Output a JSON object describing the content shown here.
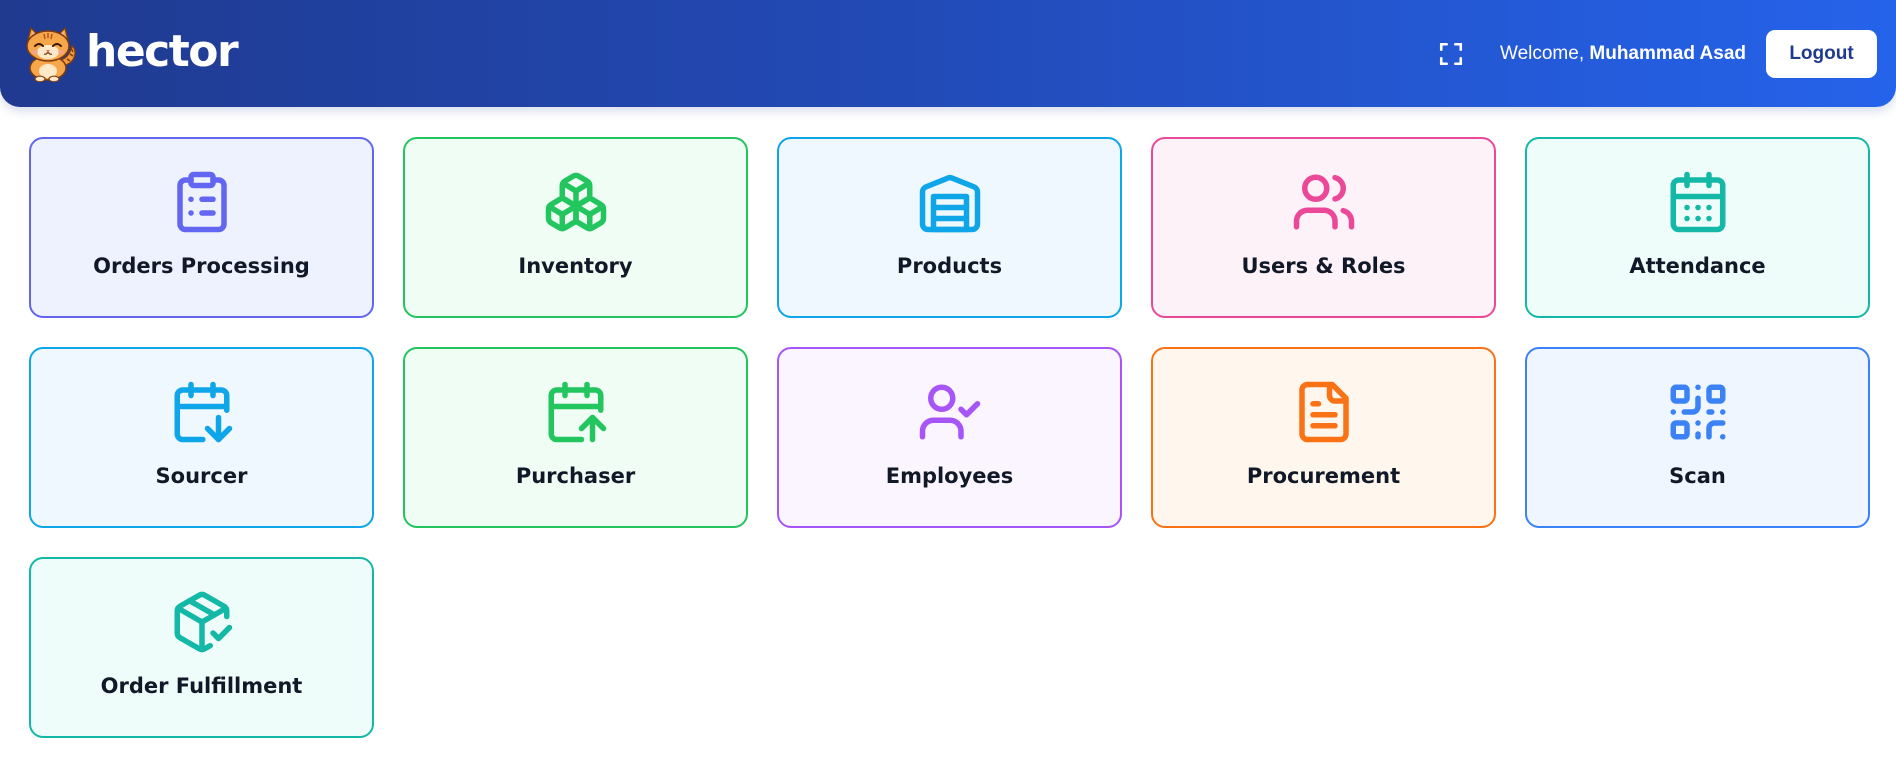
{
  "header": {
    "brand": "hector",
    "welcome_prefix": "Welcome,",
    "user_name": "Muhammad Asad",
    "logout_label": "Logout",
    "gradient_start": "#1f3a8f",
    "gradient_end": "#2563eb"
  },
  "modules": [
    {
      "label": "Orders Processing",
      "icon": "clipboard-list-icon",
      "color": "#6366f1"
    },
    {
      "label": "Inventory",
      "icon": "boxes-icon",
      "color": "#22c55e"
    },
    {
      "label": "Products",
      "icon": "warehouse-icon",
      "color": "#0ea5e9"
    },
    {
      "label": "Users & Roles",
      "icon": "users-icon",
      "color": "#ec4899"
    },
    {
      "label": "Attendance",
      "icon": "calendar-days-icon",
      "color": "#14b8a6"
    },
    {
      "label": "Sourcer",
      "icon": "calendar-arrow-down-icon",
      "color": "#0ea5e9"
    },
    {
      "label": "Purchaser",
      "icon": "calendar-arrow-up-icon",
      "color": "#22c55e"
    },
    {
      "label": "Employees",
      "icon": "user-check-icon",
      "color": "#a855f7"
    },
    {
      "label": "Procurement",
      "icon": "file-text-icon",
      "color": "#f97316"
    },
    {
      "label": "Scan",
      "icon": "qr-code-icon",
      "color": "#3b82f6"
    },
    {
      "label": "Order Fulfillment",
      "icon": "package-check-icon",
      "color": "#14b8a6"
    }
  ]
}
